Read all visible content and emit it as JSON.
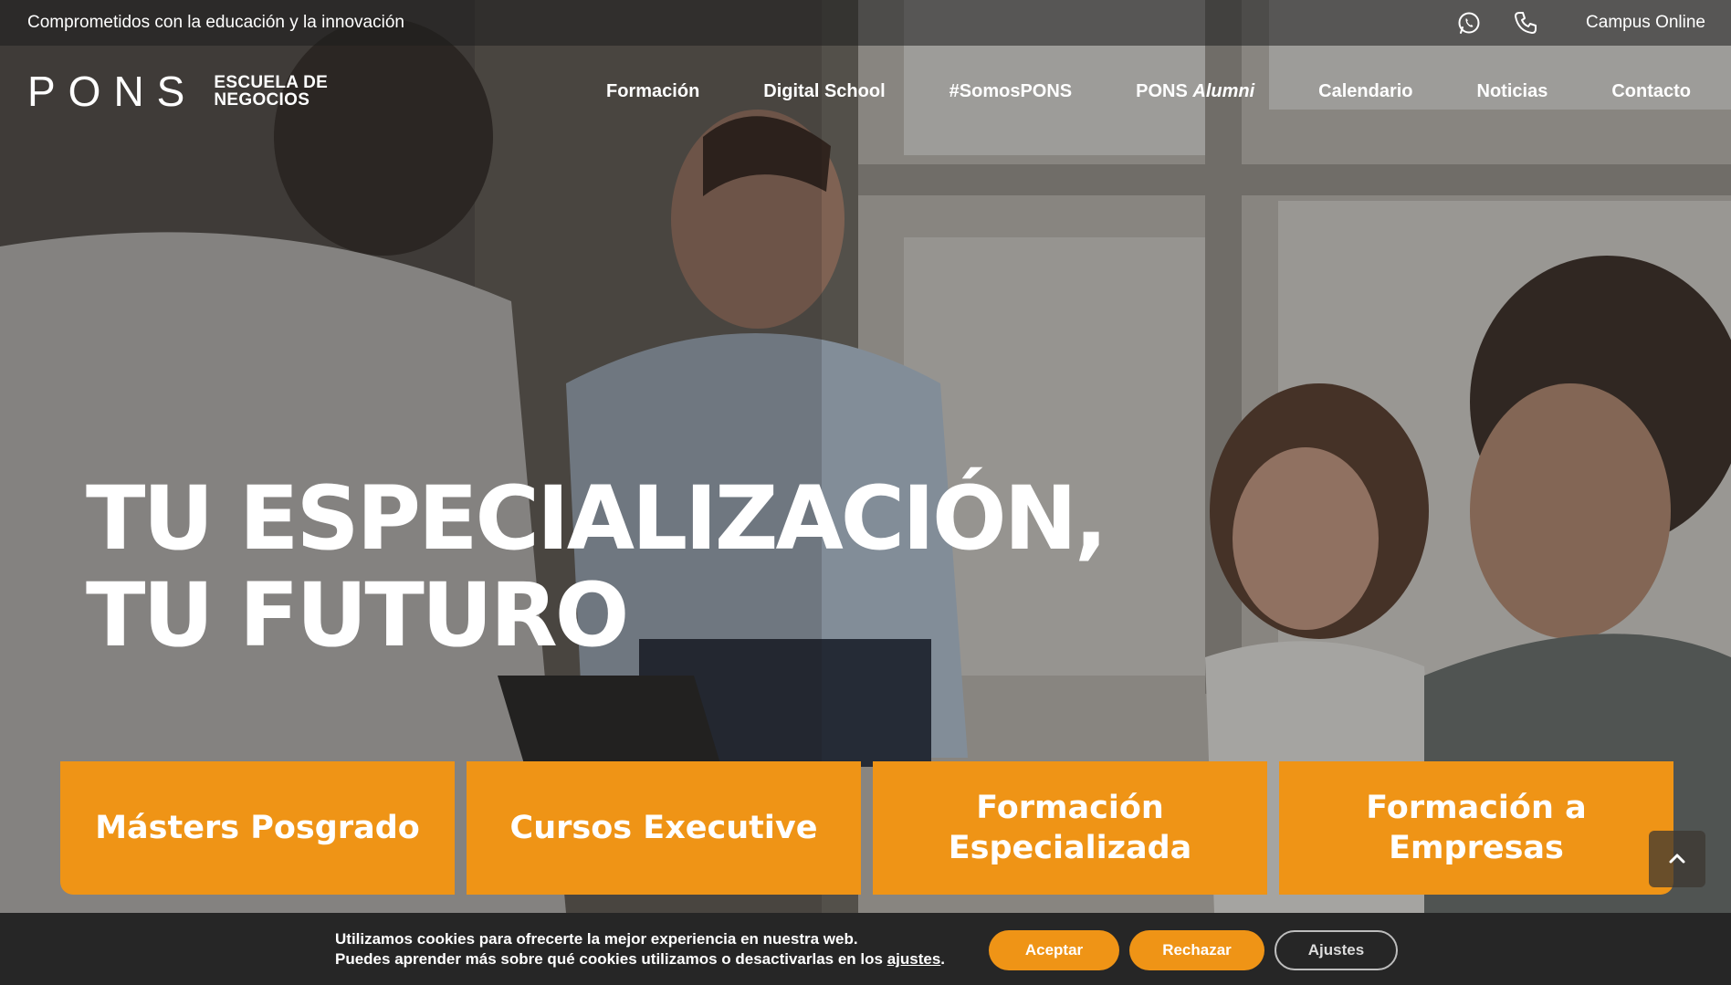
{
  "topbar": {
    "tagline": "Comprometidos con la educación y la innovación",
    "whatsapp_icon": "whatsapp-icon",
    "phone_icon": "phone-icon",
    "campus_label": "Campus Online"
  },
  "header": {
    "logo_main": "PONS",
    "logo_sub_line1": "ESCUELA DE",
    "logo_sub_line2": "NEGOCIOS",
    "nav": [
      {
        "label": "Formación"
      },
      {
        "label": "Digital School"
      },
      {
        "label": "#SomosPONS"
      },
      {
        "label": "PONS",
        "label_italic": "Alumni"
      },
      {
        "label": "Calendario"
      },
      {
        "label": "Noticias"
      },
      {
        "label": "Contacto"
      }
    ]
  },
  "hero": {
    "headline_line1": "TU ESPECIALIZACIÓN,",
    "headline_line2": "TU FUTURO",
    "cards": [
      {
        "line1": "Másters Posgrado",
        "line2": ""
      },
      {
        "line1": "Cursos Executive",
        "line2": ""
      },
      {
        "line1": "Formación",
        "line2": "Especializada"
      },
      {
        "line1": "Formación a",
        "line2": "Empresas"
      }
    ]
  },
  "scroll_top": {
    "icon": "chevron-up-icon"
  },
  "cookie": {
    "line1": "Utilizamos cookies para ofrecerte la mejor experiencia en nuestra web.",
    "line2_prefix": "Puedes aprender más sobre qué cookies utilizamos o desactivarlas en los ",
    "line2_link": "ajustes",
    "line2_suffix": ".",
    "accept_label": "Aceptar",
    "reject_label": "Rechazar",
    "settings_label": "Ajustes"
  },
  "colors": {
    "accent": "#ef9416",
    "cookie_bg": "#262626"
  }
}
